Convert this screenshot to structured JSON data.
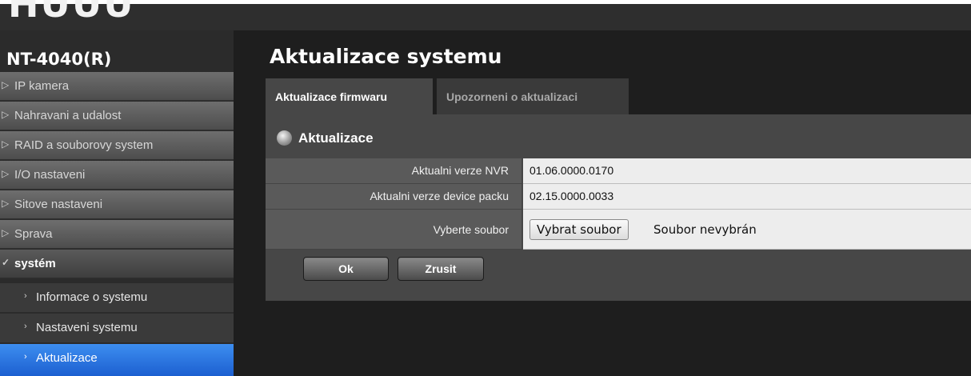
{
  "brand": {
    "logo_text": "HUUU"
  },
  "device": {
    "name": "NT-4040(R)"
  },
  "sidebar": {
    "items": [
      {
        "label": "IP kamera",
        "arrow": "▷"
      },
      {
        "label": "Nahravani a udalost",
        "arrow": "▷"
      },
      {
        "label": "RAID a souborovy system",
        "arrow": "▷"
      },
      {
        "label": "I/O nastaveni",
        "arrow": "▷"
      },
      {
        "label": "Sitove nastaveni",
        "arrow": "▷"
      },
      {
        "label": "Sprava",
        "arrow": "▷"
      },
      {
        "label": "systém",
        "arrow": "✓"
      }
    ],
    "sub_items": [
      {
        "label": "Informace o systemu",
        "arrow": "›"
      },
      {
        "label": "Nastaveni systemu",
        "arrow": "›"
      },
      {
        "label": "Aktualizace",
        "arrow": "›",
        "active": true
      }
    ]
  },
  "main": {
    "title": "Aktualizace systemu",
    "tabs": [
      {
        "label": "Aktualizace firmwaru",
        "active": true
      },
      {
        "label": "Upozorneni o aktualizaci",
        "active": false
      }
    ],
    "section_title": "Aktualizace",
    "rows": [
      {
        "label": "Aktualni verze NVR",
        "value": "01.06.0000.0170"
      },
      {
        "label": "Aktualni verze device packu",
        "value": "02.15.0000.0033"
      },
      {
        "label": "Vyberte soubor"
      }
    ],
    "file_button": "Vybrat soubor",
    "file_status": "Soubor nevybrán",
    "ok_label": "Ok",
    "cancel_label": "Zrusit"
  },
  "colors": {
    "active_item": "#2a72e0",
    "panel": "#474747",
    "background": "#1e1e1e"
  },
  "icons": {
    "section": "disc-icon",
    "collapsed": "chevron-right-icon",
    "expanded": "check-icon"
  }
}
